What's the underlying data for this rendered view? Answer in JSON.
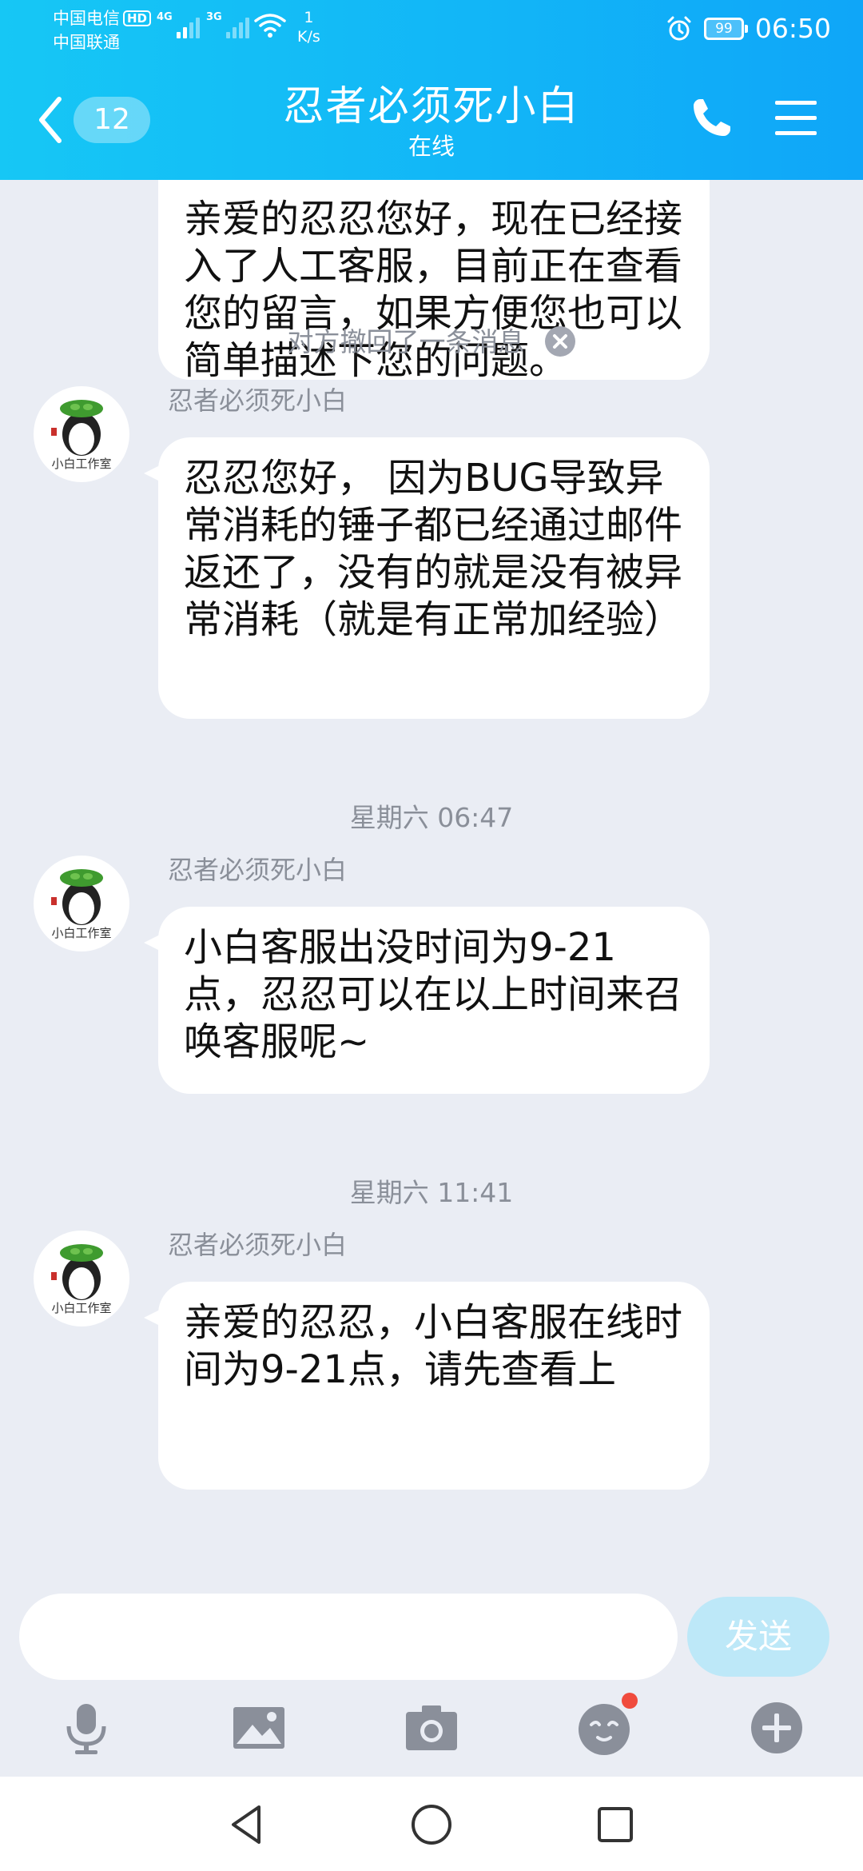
{
  "status_bar": {
    "carrier1": "中国电信",
    "hd_badge": "HD",
    "carrier2": "中国联通",
    "net1": "4G",
    "net2": "3G",
    "speed_value": "1",
    "speed_unit": "K/s",
    "battery": "99",
    "time": "06:50"
  },
  "header": {
    "unread_count": "12",
    "title": "忍者必须死小白",
    "subtitle": "在线"
  },
  "messages": [
    {
      "type": "incoming",
      "text": "亲爱的忍忍您好，现在已经接入了人工客服，目前正在查看您的留言，如果方便您也可以简单描述下您的问题。"
    },
    {
      "type": "system",
      "text": "对方撤回了一条消息"
    },
    {
      "type": "incoming",
      "sender": "忍者必须死小白",
      "text": "忍忍您好， 因为BUG导致异常消耗的锤子都已经通过邮件返还了，没有的就是没有被异常消耗（就是有正常加经验）"
    },
    {
      "type": "time",
      "text": "星期六 06:47"
    },
    {
      "type": "incoming",
      "sender": "忍者必须死小白",
      "text": "小白客服出没时间为9-21点，忍忍可以在以上时间来召唤客服呢~"
    },
    {
      "type": "time",
      "text": "星期六 11:41"
    },
    {
      "type": "incoming",
      "sender": "忍者必须死小白",
      "text": "亲爱的忍忍，小白客服在线时间为9-21点，请先查看上"
    }
  ],
  "avatar_caption": "小白工作室",
  "input": {
    "value": "",
    "send_label": "发送"
  },
  "toolbar": {
    "icons": [
      "microphone-icon",
      "image-icon",
      "camera-icon",
      "emoji-icon",
      "plus-icon"
    ]
  },
  "navbar": {
    "icons": [
      "back-triangle-icon",
      "home-circle-icon",
      "recents-square-icon"
    ]
  },
  "colors": {
    "header_start": "#16c7f5",
    "header_end": "#0fa6f8",
    "background": "#eaedf4",
    "send_disabled": "#bde8f8",
    "notification_dot": "#f04b3d"
  }
}
